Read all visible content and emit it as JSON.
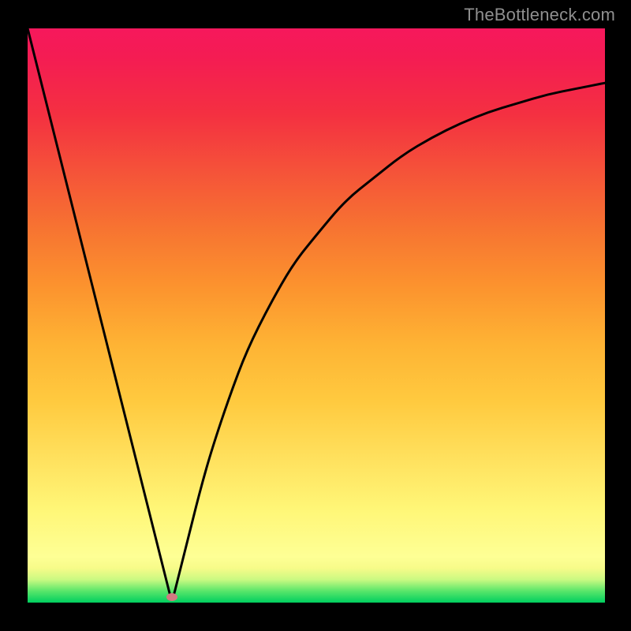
{
  "watermark": "TheBottleneck.com",
  "colors": {
    "background": "#000000",
    "gradient_top": "#f6185c",
    "gradient_mid": "#ffe15e",
    "gradient_bottom": "#00cf5f",
    "curve": "#000000",
    "marker": "#d17a81",
    "watermark_text": "#8f8f8f"
  },
  "chart_data": {
    "type": "line",
    "title": "",
    "subtitle": "",
    "xlabel": "",
    "ylabel": "",
    "xlim": [
      0,
      100
    ],
    "ylim": [
      0,
      100
    ],
    "grid": false,
    "legend": false,
    "annotations": [],
    "x": [
      0,
      2,
      4,
      6,
      8,
      10,
      12,
      14,
      16,
      18,
      20,
      22,
      24,
      25,
      26,
      28,
      30,
      32,
      35,
      38,
      42,
      46,
      50,
      55,
      60,
      65,
      70,
      75,
      80,
      85,
      90,
      95,
      100
    ],
    "y": [
      100,
      92,
      84,
      76,
      68,
      60,
      52,
      44,
      36,
      28,
      20,
      12,
      4,
      0,
      4,
      12,
      20,
      27,
      36,
      44,
      52,
      59,
      64,
      70,
      74,
      78,
      81,
      83.5,
      85.5,
      87,
      88.5,
      89.5,
      90.5
    ],
    "marker": {
      "x": 25,
      "y": 1
    }
  }
}
